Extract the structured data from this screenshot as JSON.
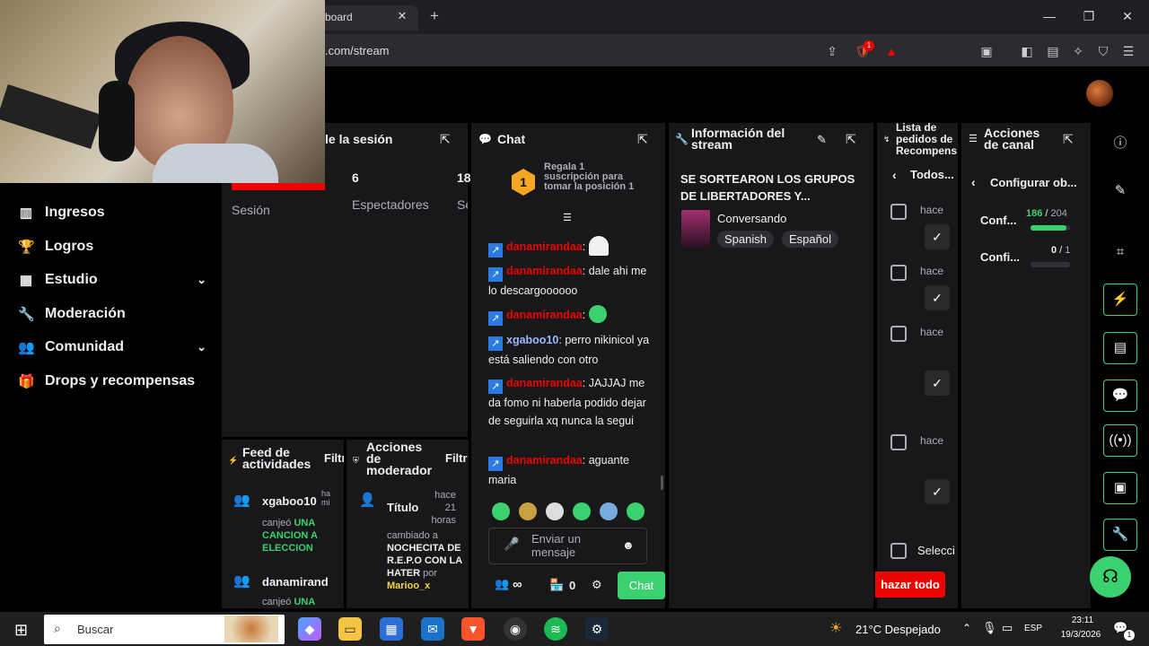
{
  "browser": {
    "tab_title": "board",
    "url": ".com/stream",
    "new_tab": "+",
    "shields_badge": "1"
  },
  "sidebar": {
    "items": [
      {
        "label": "Ingresos",
        "icon": "chart-icon",
        "glyph": "▥"
      },
      {
        "label": "Logros",
        "icon": "trophy-icon",
        "glyph": "🏆"
      },
      {
        "label": "Estudio",
        "icon": "studio-icon",
        "glyph": "▦",
        "expandable": true
      },
      {
        "label": "Moderación",
        "icon": "wrench-icon",
        "glyph": "🔧"
      },
      {
        "label": "Comunidad",
        "icon": "people-icon",
        "glyph": "👥",
        "expandable": true
      },
      {
        "label": "Drops y recompensas",
        "icon": "gift-icon",
        "glyph": "🎁"
      }
    ]
  },
  "session": {
    "title": "le la sesión",
    "viewers": "6",
    "viewers_label": "Espectadores",
    "third_value": "18",
    "third_label": "Se",
    "session_label": "Sesión"
  },
  "chat": {
    "title": "Chat",
    "sub_banner": "Regala 1 suscripción para tomar la posición 1",
    "sub_rank": "1",
    "messages": [
      {
        "user": "danamirandaa",
        "sep": ":",
        "text": "",
        "color": "r",
        "emote": true
      },
      {
        "user": "danamirandaa",
        "sep": ":",
        "text": " dale ahi me lo descargoooooo",
        "color": "r",
        "emote": false
      },
      {
        "user": "danamirandaa",
        "sep": ":",
        "text": "",
        "color": "r",
        "emote": true
      },
      {
        "user": "xgaboo10",
        "sep": ":",
        "text": " perro nikinicol ya está saliendo con otro",
        "color": "b",
        "emote": false
      },
      {
        "user": "danamirandaa",
        "sep": ":",
        "text": " JAJJAJ me da fomo ni haberla podido dejar de seguirla xq nunca la segui",
        "color": "r",
        "emote": false
      },
      {
        "user": "danamirandaa",
        "sep": ":",
        "text": " aguante maria",
        "color": "r",
        "emote": false
      }
    ],
    "input_placeholder": "Enviar un mensaje",
    "viewers_count": "∞",
    "points": "0",
    "send_label": "Chat"
  },
  "info": {
    "title": "Información del stream",
    "stream_title": "SE SORTEARON LOS GRUPOS DE LIBERTADORES Y...",
    "category": "Conversando",
    "tags": [
      "Spanish",
      "Español"
    ]
  },
  "queue": {
    "title": "Lista de pedidos de Recompens",
    "filter": "Todos...",
    "rows": [
      {
        "time": "hace"
      },
      {
        "time": "hace"
      },
      {
        "time": "hace"
      },
      {
        "time": "hace"
      }
    ],
    "select_label": "Selecci",
    "reject_all": "hazar todo"
  },
  "actions": {
    "title": "Acciones de canal",
    "header_label": "Configurar ob...",
    "goals": [
      {
        "label": "Conf...",
        "current": "186",
        "total": "204",
        "progress": 0.91
      },
      {
        "label": "Confi...",
        "current": "0",
        "total": "1",
        "progress": 0
      }
    ]
  },
  "feed": {
    "title": "Feed de actividades",
    "filter": "Filtr",
    "items": [
      {
        "user": "xgaboo10",
        "time": "ha mi",
        "action": "canjeó",
        "reward": "UNA CANCION A ELECCION"
      },
      {
        "user": "danamirand",
        "time": "",
        "action": "canjeó",
        "reward": "UNA"
      }
    ]
  },
  "mod": {
    "title": "Acciones de moderador",
    "filter": "Filtr",
    "item_title": "Título",
    "time": "hace 21 horas",
    "change_text": "cambiado a",
    "new_value": "NOCHECITA DE R.E.P.O CON LA HATER",
    "by": "por",
    "mod_user": "Marioo_x"
  },
  "taskbar": {
    "search_placeholder": "Buscar",
    "weather": "21°C Despejado",
    "language": "ESP",
    "time": "23:11",
    "date": "19/3/2026",
    "notif_count": "1"
  },
  "colors": {
    "accent_green": "#3bd16f",
    "panel_bg": "#18181b",
    "chat_red": "#eb0400",
    "danger": "#eb0400"
  }
}
